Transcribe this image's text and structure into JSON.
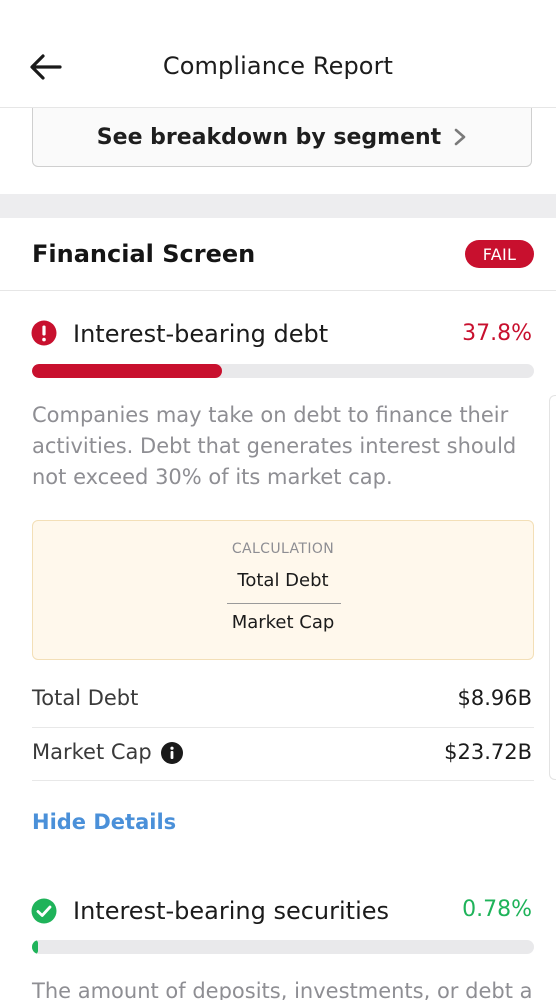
{
  "header": {
    "title": "Compliance Report",
    "back_icon": "arrow-left-icon"
  },
  "segment_button": {
    "label": "See breakdown by segment",
    "icon": "chevron-right-icon"
  },
  "financial_screen": {
    "title": "Financial Screen",
    "status": "FAIL",
    "status_color": "#c8102e"
  },
  "items": [
    {
      "status_icon": "alert-icon",
      "label": "Interest-bearing debt",
      "percent_text": "37.8%",
      "percent_value": 37.8,
      "color": "#c8102e",
      "description": "Companies may take on debt to finance their activities. Debt that generates interest should not exceed 30% of its market cap.",
      "calculation": {
        "label": "CALCULATION",
        "numerator": "Total Debt",
        "denominator": "Market Cap"
      },
      "rows": [
        {
          "label": "Total Debt",
          "value": "$8.96B"
        },
        {
          "label": "Market Cap",
          "value": "$23.72B",
          "icon": "info-icon"
        }
      ],
      "toggle_label": "Hide Details"
    },
    {
      "status_icon": "check-icon",
      "label": "Interest-bearing securities",
      "percent_text": "0.78%",
      "percent_value": 0.78,
      "color": "#1fb35a",
      "description": "The amount of deposits, investments, or debt a"
    }
  ]
}
